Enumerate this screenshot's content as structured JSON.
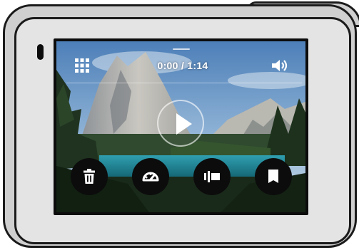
{
  "player": {
    "time_display": "0:00 / 1:14",
    "playback_position": 0.0
  },
  "icons": {
    "grid": "grid-icon",
    "volume": "speaker-volume-icon",
    "play": "play-icon",
    "delete": "trash-icon",
    "speed": "speedometer-icon",
    "trim": "trim-icon",
    "hilight": "hilight-tag-icon"
  },
  "colors": {
    "camera_body": "#cfcfcf",
    "outline": "#1a1a1a",
    "button_bg": "#0c0c0c",
    "icon": "#ffffff"
  }
}
